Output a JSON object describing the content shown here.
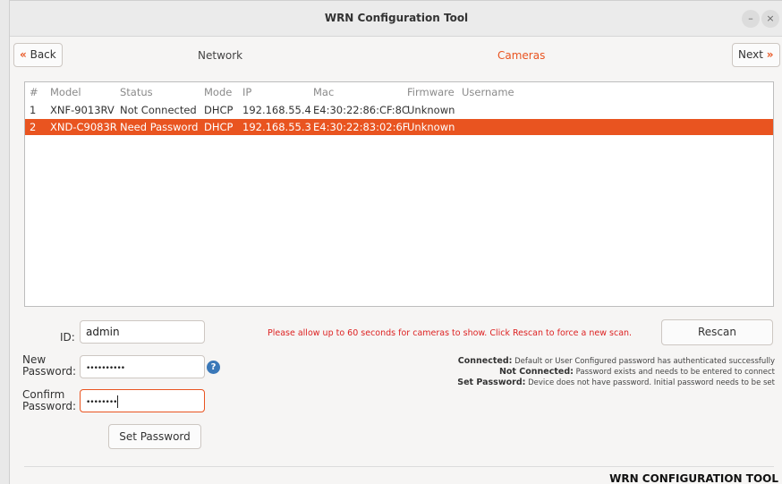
{
  "window": {
    "title": "WRN Configuration Tool",
    "minimize_glyph": "–",
    "close_glyph": "×"
  },
  "nav": {
    "back_label": "Back",
    "back_icon": "«",
    "next_label": "Next",
    "next_icon": "»",
    "steps": [
      "Network",
      "Cameras"
    ],
    "active_step": "Cameras"
  },
  "table": {
    "columns": [
      "#",
      "Model",
      "Status",
      "Mode",
      "IP",
      "Mac",
      "Firmware",
      "Username"
    ],
    "rows": [
      {
        "num": "1",
        "model": "XNF-9013RV",
        "status": "Not Connected",
        "mode": "DHCP",
        "ip": "192.168.55.4",
        "mac": "E4:30:22:86:CF:8C",
        "firmware": "Unknown",
        "username": ""
      },
      {
        "num": "2",
        "model": "XND-C9083R",
        "status": "Need Password",
        "mode": "DHCP",
        "ip": "192.168.55.3",
        "mac": "E4:30:22:83:02:6F",
        "firmware": "Unknown",
        "username": ""
      }
    ],
    "selected_row": 2
  },
  "form": {
    "id_label": "ID:",
    "id_value": "admin",
    "new_password_label": [
      "New",
      "Password:"
    ],
    "new_password_value": "••••••••••",
    "confirm_password_label": [
      "Confirm",
      "Password:"
    ],
    "confirm_password_value": "••••••••",
    "help_glyph": "?",
    "set_password_label": "Set Password"
  },
  "notice": "Please allow up to 60 seconds for cameras to show. Click Rescan to force a new scan.",
  "rescan_label": "Rescan",
  "legend": [
    {
      "term": "Connected:",
      "desc": "Default or User Configured password has authenticated successfully"
    },
    {
      "term": "Not Connected:",
      "desc": "Password exists and needs to be entered to connect"
    },
    {
      "term": "Set Password:",
      "desc": "Device does not have password. Initial password needs to be set"
    }
  ],
  "footer_brand": "WRN CONFIGURATION TOOL",
  "colors": {
    "accent": "#e95420",
    "notice": "#dd2222",
    "help": "#3a78b8"
  }
}
